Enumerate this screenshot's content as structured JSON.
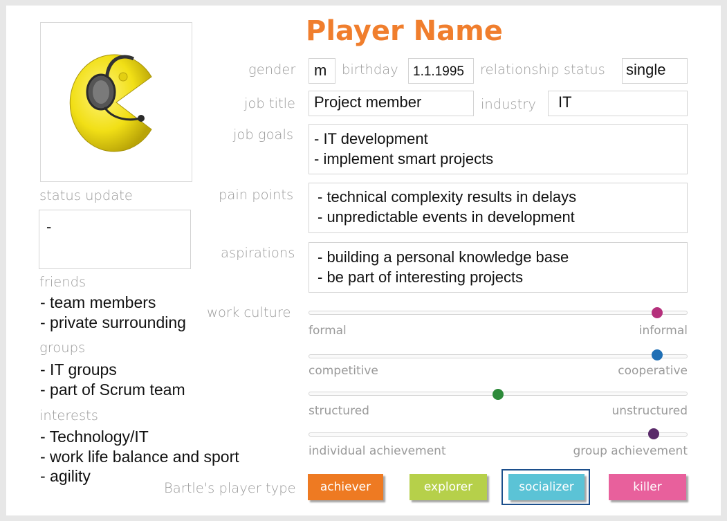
{
  "title": "Player Name",
  "avatar": {
    "icon": "pacman-headset-icon",
    "color": "#f3e21a"
  },
  "status_update": {
    "label": "status update",
    "value": "-"
  },
  "friends": {
    "label": "friends",
    "items": [
      "- team members",
      "- private surrounding"
    ]
  },
  "groups": {
    "label": "groups",
    "items": [
      "- IT groups",
      "- part of Scrum team"
    ]
  },
  "interests": {
    "label": "interests",
    "items": [
      "- Technology/IT",
      "- work life balance and sport",
      "- agility"
    ]
  },
  "gender": {
    "label": "gender",
    "value": "m"
  },
  "birthday": {
    "label": "birthday",
    "value": "1.1.1995"
  },
  "relationship": {
    "label": "relationship status",
    "value": "single"
  },
  "job_title": {
    "label": "job title",
    "value": "Project member"
  },
  "industry": {
    "label": "industry",
    "value": "IT"
  },
  "job_goals": {
    "label": "job goals",
    "items": [
      "- IT development",
      "- implement smart projects"
    ]
  },
  "pain_points": {
    "label": "pain points",
    "items": [
      "- technical complexity results in delays",
      "- unpredictable events in development"
    ]
  },
  "aspirations": {
    "label": "aspirations",
    "items": [
      "- building a personal knowledge base",
      "- be part of interesting projects"
    ]
  },
  "work_culture_label": "work culture",
  "scales": [
    {
      "left": "formal",
      "right": "informal",
      "value": 0.92,
      "color": "#b5307c"
    },
    {
      "left": "competitive",
      "right": "cooperative",
      "value": 0.92,
      "color": "#1f6fb5"
    },
    {
      "left": "structured",
      "right": "unstructured",
      "value": 0.5,
      "color": "#2d8a3a"
    },
    {
      "left": "individual achievement",
      "right": "group achievement",
      "value": 0.91,
      "color": "#5a2a6a"
    }
  ],
  "bartle": {
    "label": "Bartle's player type",
    "types": [
      {
        "label": "achiever",
        "color": "#ee7a22"
      },
      {
        "label": "explorer",
        "color": "#b6d04a"
      },
      {
        "label": "socializer",
        "color": "#5bc3d6",
        "selected": true
      },
      {
        "label": "killer",
        "color": "#e8609c"
      }
    ],
    "selected_border": "#1c4f8c"
  }
}
